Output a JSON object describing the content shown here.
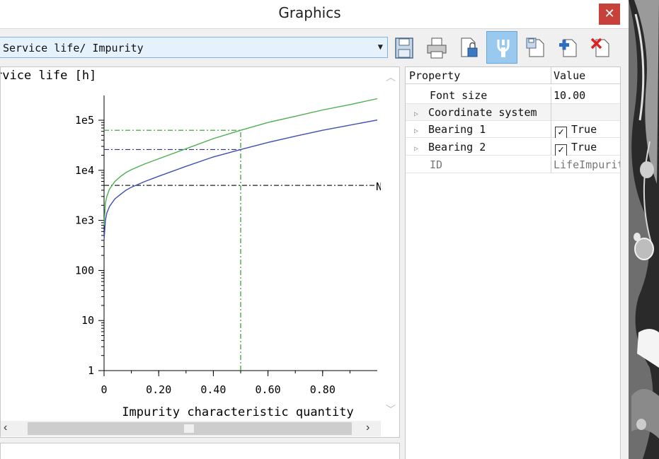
{
  "window": {
    "title": "Graphics",
    "close_glyph": "✕"
  },
  "toolbar": {
    "selected_view": "Service life/ Impurity",
    "dropdown_icon": "dropdown-arrow-icon",
    "buttons": [
      {
        "icon": "save-icon"
      },
      {
        "icon": "print-icon"
      },
      {
        "icon": "export-lock-icon"
      },
      {
        "icon": "settings-tool-icon",
        "active": true
      },
      {
        "icon": "save-page-icon"
      },
      {
        "icon": "add-page-icon"
      },
      {
        "icon": "delete-page-icon"
      }
    ]
  },
  "plot": {
    "ylabel": "rvice life [h]",
    "xlabel": "Impurity characteristic quantity",
    "truncated_label": "N",
    "colors": {
      "series1": "#4caf50",
      "series2": "#3f4fb0",
      "ref_green": "#2e9a2e",
      "ref_blue": "#33338a",
      "ref_black": "#222222"
    }
  },
  "chart_data": {
    "type": "line",
    "title": "",
    "xlabel": "Impurity characteristic quantity",
    "ylabel": "rvice life [h]",
    "yscale": "log",
    "xlim": [
      0,
      1.0
    ],
    "ylim": [
      1,
      500000
    ],
    "x_ticks": [
      0,
      0.2,
      0.4,
      0.6,
      0.8
    ],
    "x_tick_labels": [
      "0",
      "0.20",
      "0.40",
      "0.60",
      "0.80"
    ],
    "y_ticks": [
      1,
      10,
      100,
      1000,
      10000,
      100000
    ],
    "y_tick_labels": [
      "1",
      "10",
      "100",
      "1e3",
      "1e4",
      "1e5"
    ],
    "grid": false,
    "series": [
      {
        "x": [
          0,
          0.005,
          0.01,
          0.02,
          0.04,
          0.06,
          0.08,
          0.1,
          0.15,
          0.2,
          0.3,
          0.4,
          0.5,
          0.6,
          0.7,
          0.8,
          0.9,
          1.0
        ],
        "y": [
          800,
          2200,
          3000,
          4200,
          6000,
          7500,
          9000,
          10300,
          13500,
          17000,
          27000,
          43000,
          63000,
          90000,
          120000,
          160000,
          205000,
          270000
        ]
      },
      {
        "x": [
          0,
          0.005,
          0.01,
          0.02,
          0.04,
          0.06,
          0.08,
          0.1,
          0.15,
          0.2,
          0.3,
          0.4,
          0.5,
          0.6,
          0.7,
          0.8,
          0.9,
          1.0
        ],
        "y": [
          400,
          1000,
          1400,
          1900,
          2700,
          3300,
          4000,
          4600,
          6000,
          7600,
          12000,
          18500,
          26000,
          36000,
          48000,
          63000,
          80000,
          101000
        ]
      }
    ],
    "reference_lines": [
      {
        "kind": "h",
        "y": 63000,
        "x_to": 0.5,
        "color": "green"
      },
      {
        "kind": "h",
        "y": 26000,
        "x_to": 0.5,
        "color": "blue"
      },
      {
        "kind": "h",
        "y": 5000,
        "x_to": 1.0,
        "color": "black"
      },
      {
        "kind": "v",
        "x": 0.5,
        "y_to": 63000,
        "color": "green"
      }
    ]
  },
  "properties": {
    "headers": {
      "name": "Property",
      "value": "Value"
    },
    "rows": [
      {
        "name": "Font size",
        "value": "10.00",
        "type": "plain"
      },
      {
        "name": "Coordinate system",
        "value": "",
        "type": "group"
      },
      {
        "name": "Bearing 1",
        "value": "True",
        "type": "check"
      },
      {
        "name": "Bearing 2",
        "value": "True",
        "type": "check"
      },
      {
        "name": "ID",
        "value": "LifeImpurit",
        "type": "muted"
      }
    ]
  }
}
